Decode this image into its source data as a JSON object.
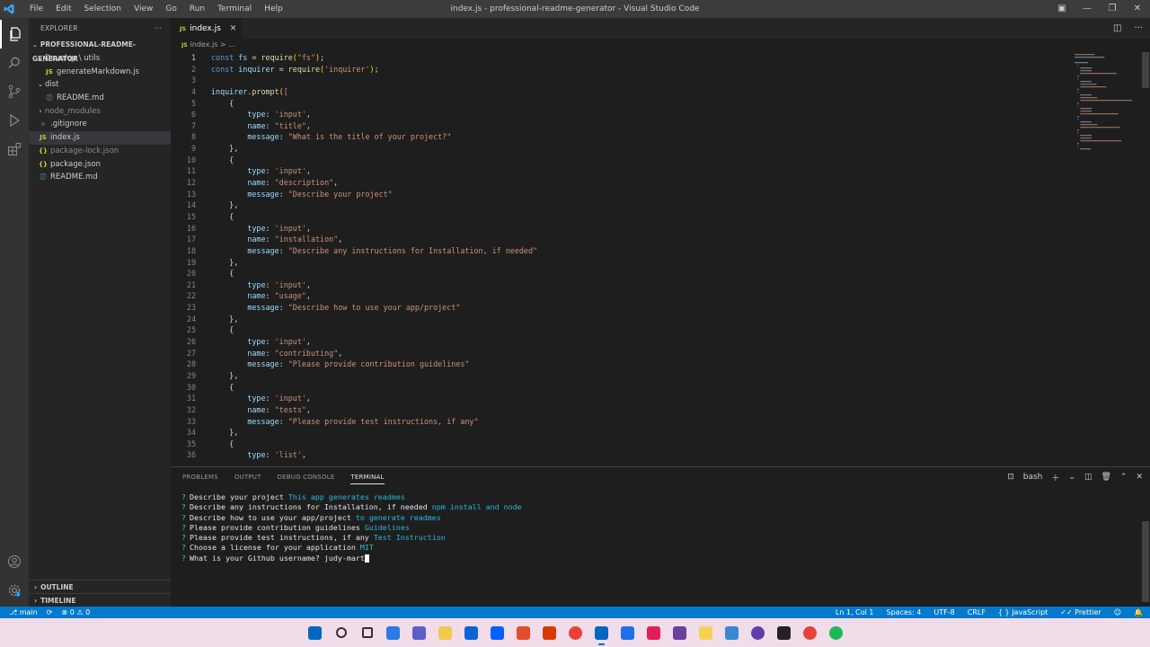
{
  "window": {
    "title": "index.js - professional-readme-generator - Visual Studio Code",
    "menu": [
      "File",
      "Edit",
      "Selection",
      "View",
      "Go",
      "Run",
      "Terminal",
      "Help"
    ]
  },
  "explorer": {
    "header": "EXPLORER",
    "project": "PROFESSIONAL-README-GENERATOR",
    "items": [
      {
        "label": "Develop \\ utils",
        "type": "folder-open",
        "indent": 1
      },
      {
        "label": "generateMarkdown.js",
        "type": "js",
        "indent": 2
      },
      {
        "label": "dist",
        "type": "folder-open",
        "indent": 1
      },
      {
        "label": "README.md",
        "type": "md",
        "indent": 2
      },
      {
        "label": "node_modules",
        "type": "folder-closed",
        "indent": 1
      },
      {
        "label": ".gitignore",
        "type": "git",
        "indent": 1
      },
      {
        "label": "index.js",
        "type": "js",
        "indent": 1
      },
      {
        "label": "package-lock.json",
        "type": "json",
        "indent": 1
      },
      {
        "label": "package.json",
        "type": "json",
        "indent": 1
      },
      {
        "label": "README.md",
        "type": "md",
        "indent": 1
      }
    ],
    "outline": "OUTLINE",
    "timeline": "TIMELINE"
  },
  "editor": {
    "tab_label": "index.js",
    "tab_icon": "JS",
    "breadcrumb": "index.js > ...",
    "lines": [
      "const fs = require(\"fs\");",
      "const inquirer = require('inquirer');",
      "",
      "inquirer.prompt([",
      "    {",
      "        type: 'input',",
      "        name: \"title\",",
      "        message: \"What is the title of your project?\"",
      "    },",
      "    {",
      "        type: 'input',",
      "        name: \"description\",",
      "        message: \"Describe your project\"",
      "    },",
      "    {",
      "        type: 'input',",
      "        name: \"installation\",",
      "        message: \"Describe any instructions for Installation, if needed\"",
      "    },",
      "    {",
      "        type: 'input',",
      "        name: \"usage\",",
      "        message: \"Describe how to use your app/project\"",
      "    },",
      "    {",
      "        type: 'input',",
      "        name: \"contributing\",",
      "        message: \"Please provide contribution guidelines\"",
      "    },",
      "    {",
      "        type: 'input',",
      "        name: \"tests\",",
      "        message: \"Please provide test instructions, if any\"",
      "    },",
      "    {",
      "        type: 'list',"
    ]
  },
  "panel": {
    "tabs": [
      "PROBLEMS",
      "OUTPUT",
      "DEBUG CONSOLE",
      "TERMINAL"
    ],
    "active_tab": "TERMINAL",
    "shell": "bash",
    "terminal_lines": [
      {
        "prompt": "?",
        "question": "Describe your project",
        "answer": "This app generates readmes"
      },
      {
        "prompt": "?",
        "question": "Describe any instructions for Installation, if needed",
        "answer": "npm install and node"
      },
      {
        "prompt": "?",
        "question": "Describe how to use your app/project",
        "answer": "to generate readmes"
      },
      {
        "prompt": "?",
        "question": "Please provide contribution guidelines",
        "answer": "Guidelines"
      },
      {
        "prompt": "?",
        "question": "Please provide test instructions, if any",
        "answer": "Test Instruction"
      },
      {
        "prompt": "?",
        "question": "Choose a license for your application",
        "answer": "MIT"
      },
      {
        "prompt": "?",
        "question": "What is your Github username?",
        "answer": "judy-mart",
        "typing": true
      }
    ]
  },
  "status": {
    "branch": "main",
    "errors": "0",
    "warnings": "0",
    "position": "Ln 1, Col 1",
    "spaces": "Spaces: 4",
    "encoding": "UTF-8",
    "eol": "CRLF",
    "language": "JavaScript",
    "formatter": "Prettier"
  },
  "colors": {
    "accent": "#007acc",
    "keyword": "#569cd6",
    "string": "#ce9178",
    "variable": "#9cdcfe",
    "function": "#dcdcaa",
    "terminal_green": "#23d18b",
    "terminal_cyan": "#29b8db",
    "taskbar": "#f1dcea"
  },
  "taskbar": {
    "icons": [
      "windows-start-icon",
      "search-icon",
      "task-view-icon",
      "widgets-icon",
      "teams-chat-icon",
      "file-explorer-icon",
      "mail-icon",
      "dropbox-icon",
      "git-icon",
      "office-icon",
      "chrome-icon",
      "vscode-icon",
      "sourcetree-icon",
      "slack-icon",
      "visual-studio-icon",
      "sticky-notes-icon",
      "photos-icon",
      "obs-icon",
      "terminal-icon",
      "chrome-icon-2",
      "spotify-icon"
    ]
  }
}
